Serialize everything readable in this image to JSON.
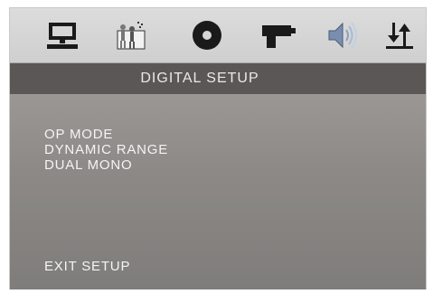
{
  "header": {
    "title": "DIGITAL SETUP"
  },
  "tabs": [
    {
      "icon": "monitor-icon"
    },
    {
      "icon": "people-icon"
    },
    {
      "icon": "disc-icon"
    },
    {
      "icon": "spray-gun-icon"
    },
    {
      "icon": "speaker-icon"
    },
    {
      "icon": "up-down-arrows-icon"
    }
  ],
  "menu": {
    "items": [
      {
        "label": "OP MODE"
      },
      {
        "label": "DYNAMIC RANGE"
      },
      {
        "label": "DUAL MONO"
      }
    ],
    "exit_label": "EXIT SETUP"
  },
  "colors": {
    "icon_bar": "#d6d6d6",
    "title_bar": "#5b5756",
    "panel": "#8e8b88",
    "text": "#f4f4f4"
  }
}
